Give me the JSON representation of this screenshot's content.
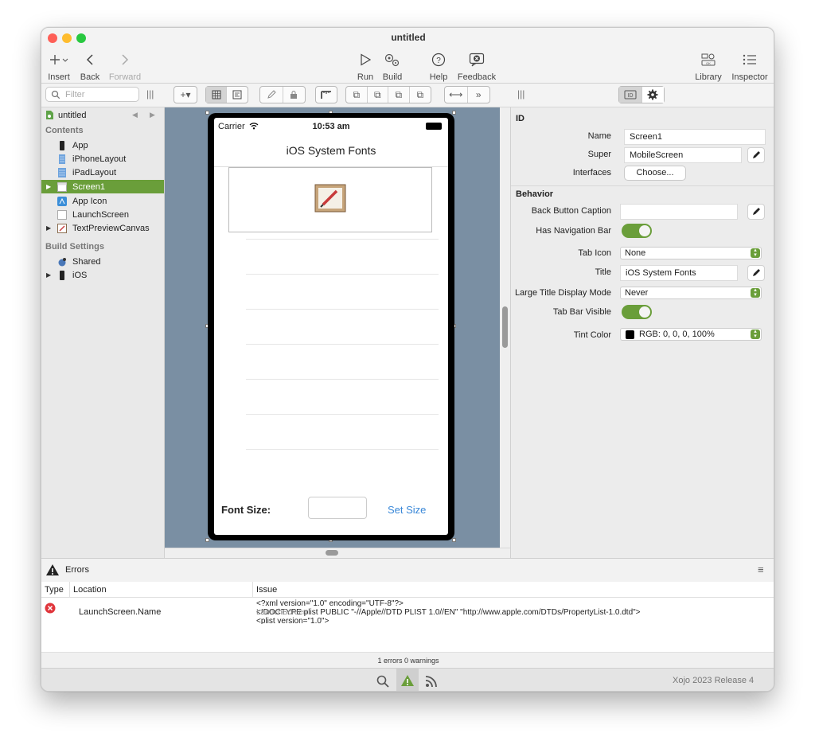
{
  "window": {
    "title": "untitled"
  },
  "toolbar": {
    "insert": "Insert",
    "back": "Back",
    "forward": "Forward",
    "run": "Run",
    "build": "Build",
    "help": "Help",
    "feedback": "Feedback",
    "library": "Library",
    "inspector": "Inspector"
  },
  "navigator": {
    "filter_placeholder": "Filter",
    "project": "untitled",
    "contents_header": "Contents",
    "items": [
      "App",
      "iPhoneLayout",
      "iPadLayout",
      "Screen1",
      "App Icon",
      "LaunchScreen",
      "TextPreviewCanvas"
    ],
    "build_header": "Build Settings",
    "build_items": [
      "Shared",
      "iOS"
    ]
  },
  "phone": {
    "carrier": "Carrier",
    "time": "10:53 am",
    "title": "iOS System Fonts",
    "font_size_label": "Font Size:",
    "set_size": "Set Size"
  },
  "inspector": {
    "id_header": "ID",
    "name_label": "Name",
    "name_value": "Screen1",
    "super_label": "Super",
    "super_value": "MobileScreen",
    "interfaces_label": "Interfaces",
    "choose": "Choose...",
    "behavior_header": "Behavior",
    "back_caption_label": "Back Button Caption",
    "back_caption_value": "",
    "has_nav_label": "Has Navigation Bar",
    "tab_icon_label": "Tab Icon",
    "tab_icon_value": "None",
    "title_label": "Title",
    "title_value": "iOS System Fonts",
    "large_title_label": "Large Title Display Mode",
    "large_title_value": "Never",
    "tab_bar_label": "Tab Bar Visible",
    "tint_label": "Tint Color",
    "tint_value": "RGB: 0, 0, 0, 100%"
  },
  "errors": {
    "title": "Errors",
    "col_type": "Type",
    "col_location": "Location",
    "col_issue": "Issue",
    "row_location": "LaunchScreen.Name",
    "issue_line1": "<?xml version=\"1.0\" encoding=\"UTF-8\"?>",
    "issue_line2": "LaunchScreen",
    "issue_line3": "<!DOCTYPE plist PUBLIC \"-//Apple//DTD PLIST 1.0//EN\" \"http://www.apple.com/DTDs/PropertyList-1.0.dtd\">",
    "issue_line4": "<plist version=\"1.0\">",
    "status": "1 errors 0 warnings"
  },
  "statusbar": {
    "version": "Xojo 2023 Release 4"
  },
  "colors": {
    "accent": "#6a9e3a",
    "canvas": "#7a8fa3",
    "link": "#3a88d8",
    "error": "#e0353b"
  }
}
